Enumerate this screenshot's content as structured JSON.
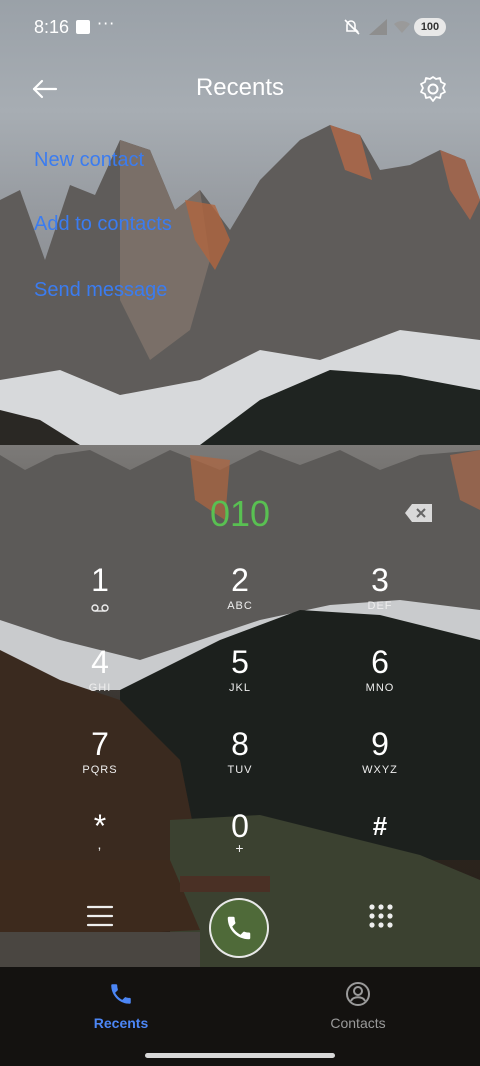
{
  "status_bar": {
    "time": "8:16",
    "more_indicator": "···",
    "battery": "100",
    "icons": [
      "app-square-icon",
      "mute-icon",
      "signal-icon",
      "wifi-icon",
      "battery-icon"
    ]
  },
  "header": {
    "title": "Recents",
    "back_icon": "arrow-left-icon",
    "settings_icon": "gear-icon"
  },
  "options": {
    "new_contact": "New contact",
    "add_to_contacts": "Add to contacts",
    "send_message": "Send message"
  },
  "dialer": {
    "number": "010",
    "number_color": "#59c052",
    "backspace_icon": "backspace-icon",
    "keys": [
      {
        "digit": "1",
        "sub": "voicemail-icon"
      },
      {
        "digit": "2",
        "sub": "ABC"
      },
      {
        "digit": "3",
        "sub": "DEF"
      },
      {
        "digit": "4",
        "sub": "GHI"
      },
      {
        "digit": "5",
        "sub": "JKL"
      },
      {
        "digit": "6",
        "sub": "MNO"
      },
      {
        "digit": "7",
        "sub": "PQRS"
      },
      {
        "digit": "8",
        "sub": "TUV"
      },
      {
        "digit": "9",
        "sub": "WXYZ"
      },
      {
        "digit": "*",
        "sub": ","
      },
      {
        "digit": "0",
        "sub": "+"
      },
      {
        "digit": "#",
        "sub": ""
      }
    ]
  },
  "actions": {
    "menu_icon": "menu-icon",
    "call_icon": "phone-icon",
    "keypad_icon": "keypad-icon",
    "call_color": "#4f6a39"
  },
  "nav": {
    "recents_label": "Recents",
    "contacts_label": "Contacts",
    "active_color": "#4c86f5"
  }
}
